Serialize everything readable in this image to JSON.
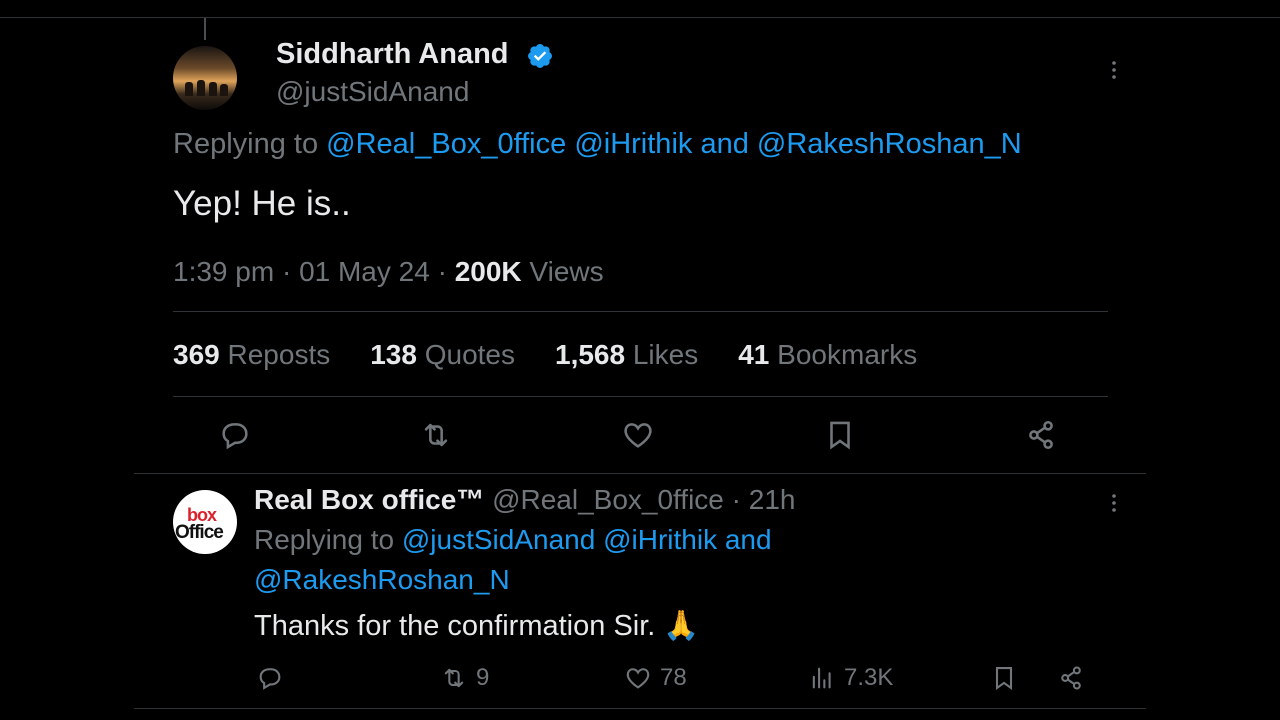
{
  "main_tweet": {
    "name": "Siddharth Anand",
    "handle": "@justSidAnand",
    "replying_prefix": "Replying to",
    "mention_1": "@Real_Box_0ffice",
    "mention_2": "@iHrithik",
    "and_word": "and",
    "mention_3": "@RakeshRoshan_N",
    "text": "Yep! He is..",
    "time": "1:39 pm",
    "date": "01 May 24",
    "views_count": "200K",
    "views_label": "Views",
    "sep": "·",
    "stats": {
      "reposts_count": "369",
      "reposts_label": "Reposts",
      "quotes_count": "138",
      "quotes_label": "Quotes",
      "likes_count": "1,568",
      "likes_label": "Likes",
      "bookmarks_count": "41",
      "bookmarks_label": "Bookmarks"
    }
  },
  "reply_tweet": {
    "name": "Real Box office™",
    "handle": "@Real_Box_0ffice",
    "age": "21h",
    "sep": "·",
    "replying_prefix": "Replying to",
    "mention_1": "@justSidAnand",
    "mention_2": "@iHrithik",
    "and_word": "and",
    "mention_3": "@RakeshRoshan_N",
    "text": "Thanks for the confirmation Sir. 🙏",
    "reposts": "9",
    "likes": "78",
    "views": "7.3K",
    "avatar_text_top": "box",
    "avatar_text_bottom": "Office"
  },
  "icons": [
    "verified-badge-icon",
    "more-icon",
    "reply-icon",
    "repost-icon",
    "like-icon",
    "bookmark-icon",
    "share-icon",
    "views-icon"
  ],
  "colors": {
    "background": "#000000",
    "text": "#e7e9ea",
    "muted": "#71767b",
    "link": "#1d9bf0",
    "divider": "#2f3336"
  }
}
